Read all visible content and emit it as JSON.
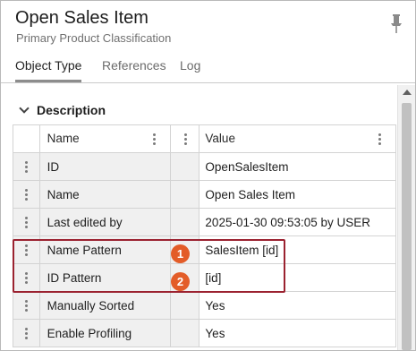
{
  "header": {
    "title": "Open Sales Item",
    "subtitle": "Primary Product Classification"
  },
  "tabs": [
    {
      "label": "Object Type",
      "active": true
    },
    {
      "label": "References",
      "active": false
    },
    {
      "label": "Log",
      "active": false
    }
  ],
  "section": {
    "label": "Description",
    "expanded": true
  },
  "table": {
    "columns": {
      "name": "Name",
      "value": "Value"
    },
    "rows": [
      {
        "name": "ID",
        "value": "OpenSalesItem"
      },
      {
        "name": "Name",
        "value": "Open Sales Item"
      },
      {
        "name": "Last edited by",
        "value": "2025-01-30 09:53:05 by USER"
      },
      {
        "name": "Name Pattern",
        "value": "SalesItem [id]"
      },
      {
        "name": "ID Pattern",
        "value": "[id]"
      },
      {
        "name": "Manually Sorted",
        "value": "Yes"
      },
      {
        "name": "Enable Profiling",
        "value": "Yes"
      }
    ]
  },
  "annotations": [
    {
      "number": "1",
      "row": "Name Pattern"
    },
    {
      "number": "2",
      "row": "ID Pattern"
    }
  ],
  "colors": {
    "highlight_border": "#9b2230",
    "badge": "#e35c28"
  },
  "icons": {
    "pin": "pin-icon",
    "expand": "chevron-down-icon",
    "column_menu": "vertical-ellipsis-icon",
    "row_handle": "vertical-ellipsis-icon"
  }
}
